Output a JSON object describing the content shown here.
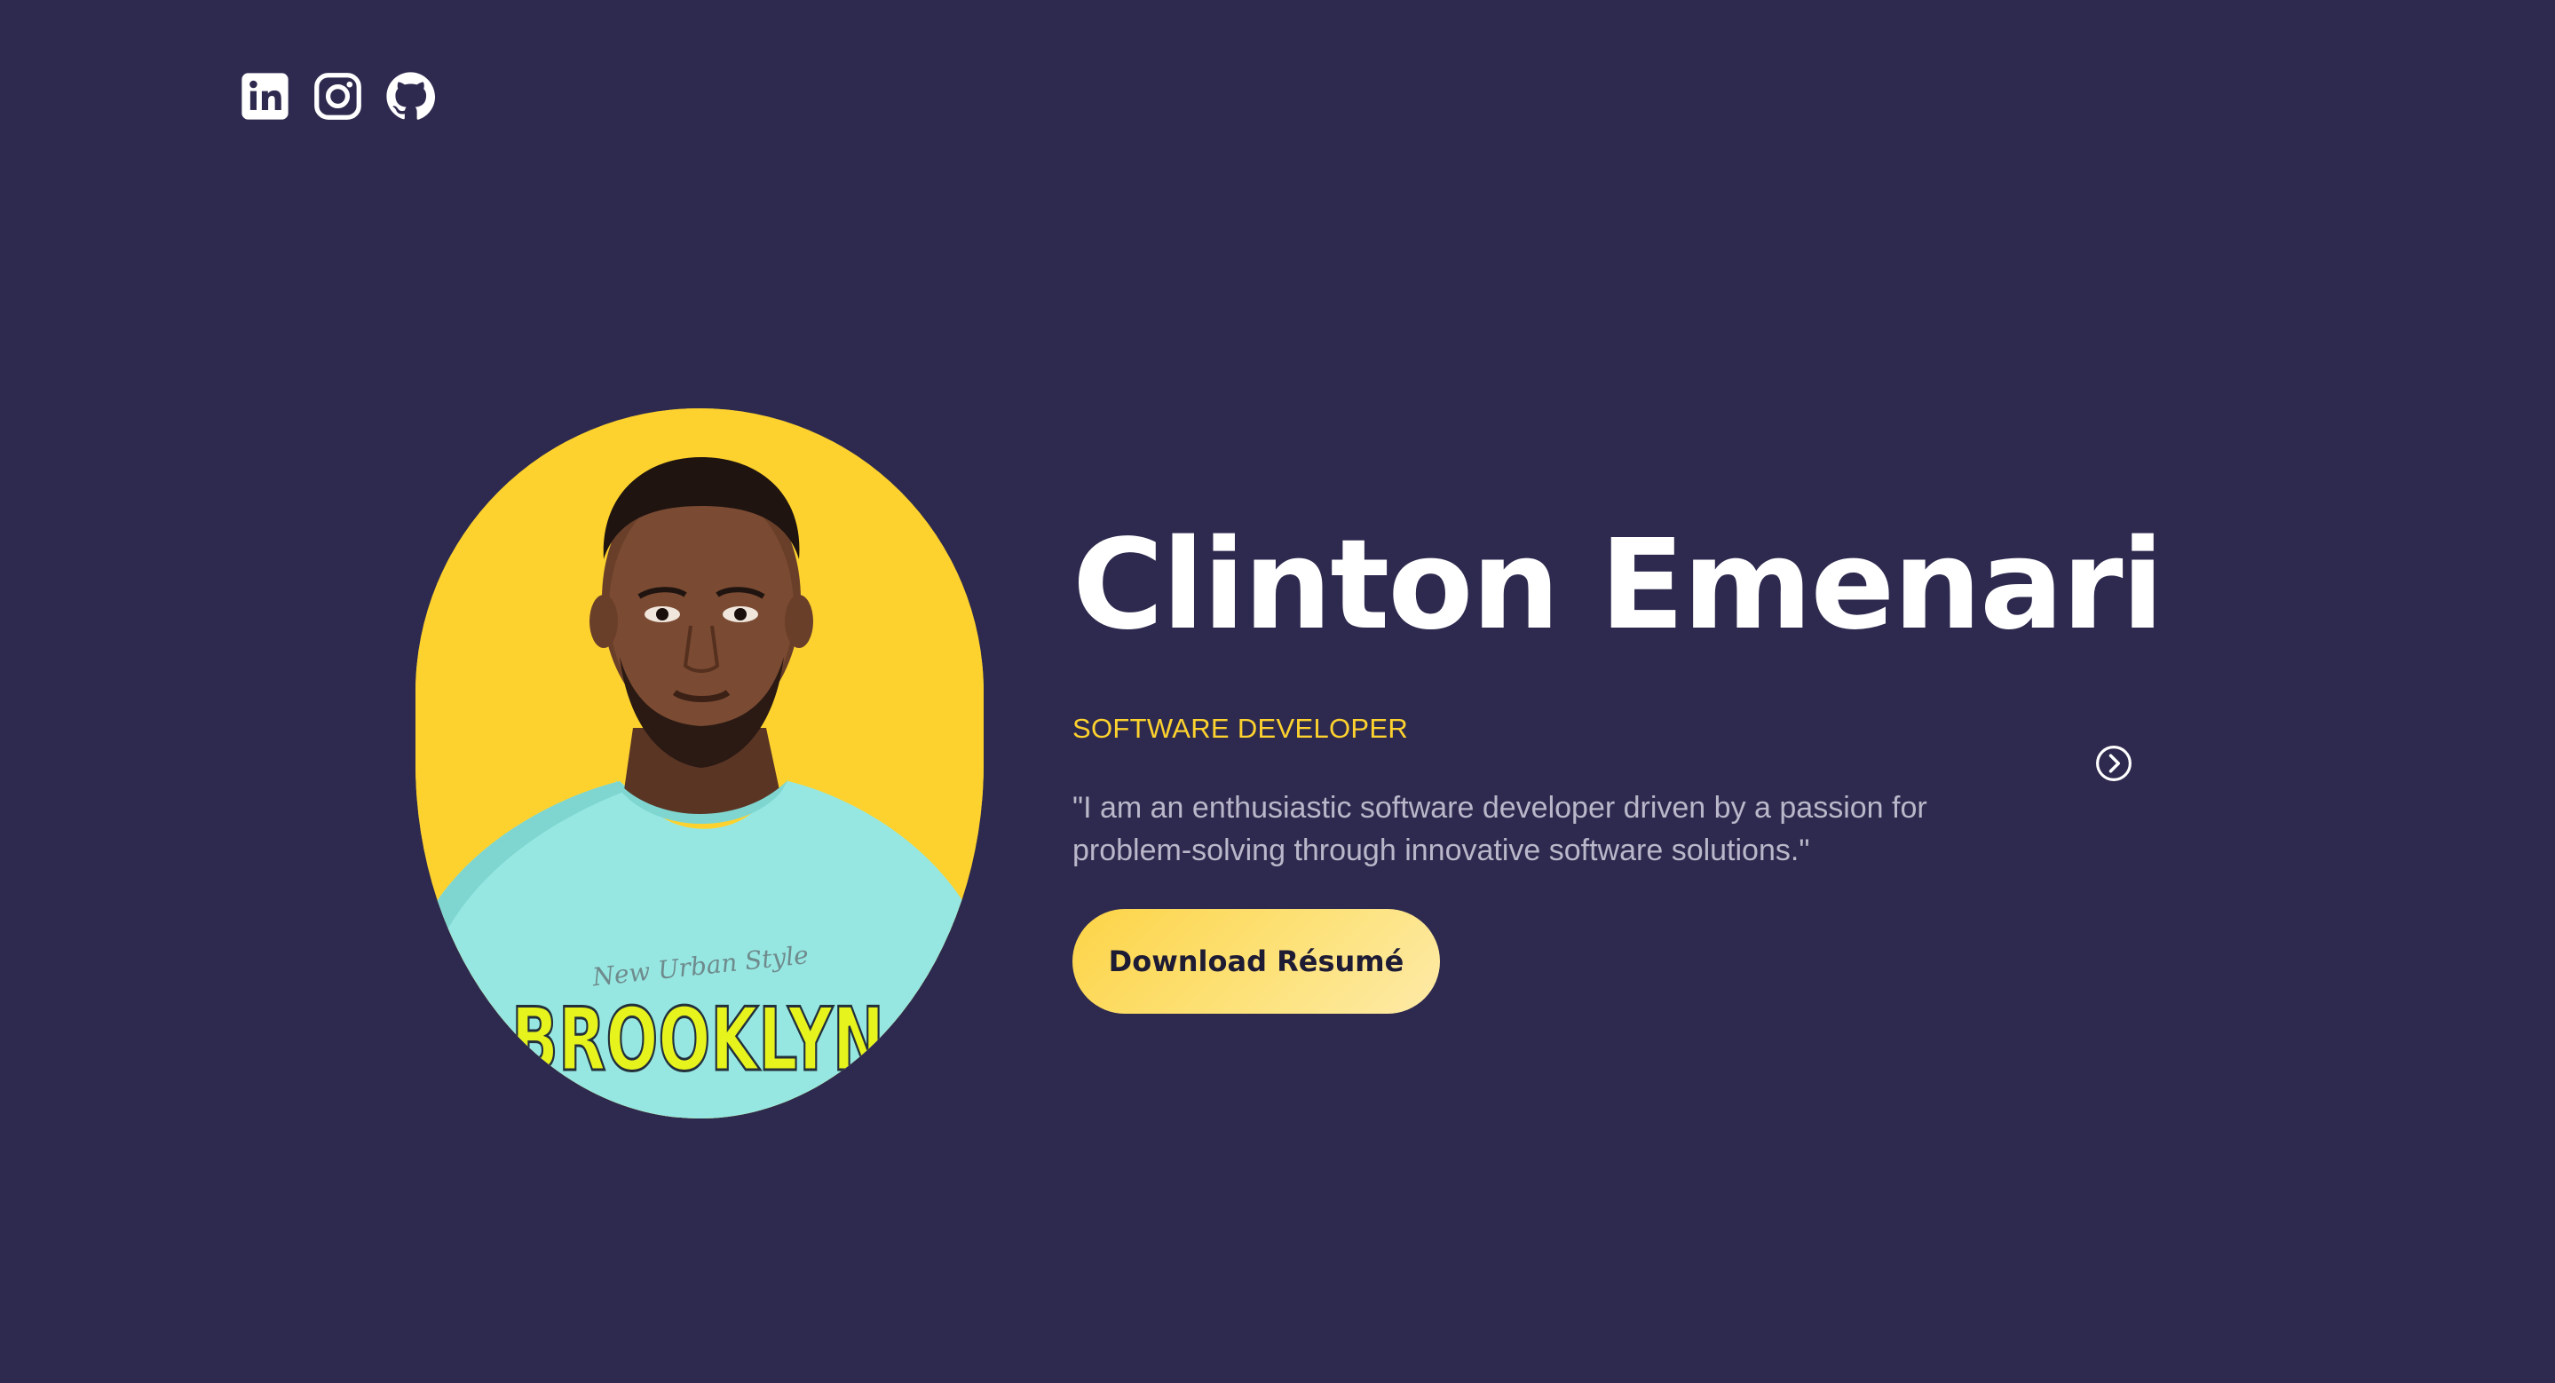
{
  "social": {
    "items": [
      {
        "icon": "linkedin-icon"
      },
      {
        "icon": "instagram-icon"
      },
      {
        "icon": "github-icon"
      }
    ]
  },
  "profile": {
    "name": "Clinton Emenari",
    "role": "SOFTWARE DEVELOPER",
    "quote": "\"I am an enthusiastic software developer driven by a passion for problem-solving through innovative software solutions.\"",
    "photo_alt": "Clinton Emenari portrait",
    "shirt_text": "BROOKLYN",
    "shirt_subtext": "New Urban Style"
  },
  "actions": {
    "download_label": "Download Résumé",
    "next_icon": "chevron-right-circle-icon"
  },
  "colors": {
    "background": "#2e2a4f",
    "accent": "#fdd22e",
    "text": "#ffffff",
    "muted": "#b9b7c9"
  }
}
